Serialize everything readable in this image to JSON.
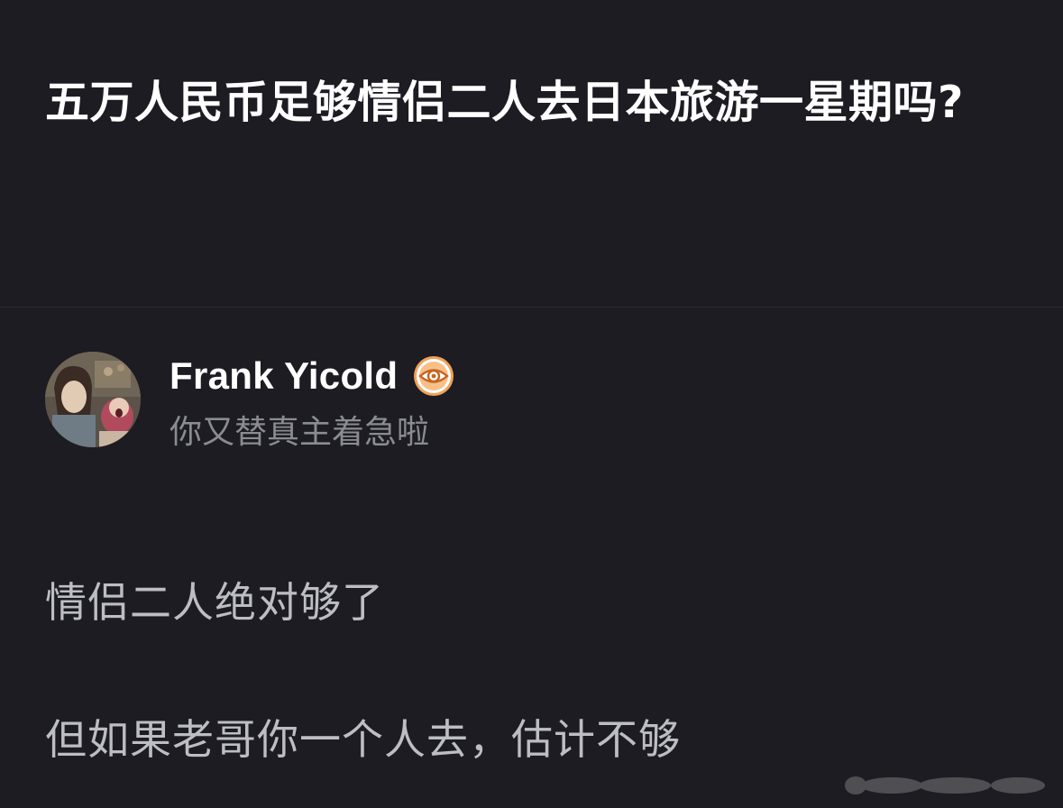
{
  "question": {
    "title": "五万人民币足够情侣二人去日本旅游一星期吗?"
  },
  "answer": {
    "author": {
      "name": "Frank Yicold",
      "bio": "你又替真主着急啦",
      "badge_icon": "verified-badge-icon"
    },
    "paragraphs": [
      "情侣二人绝对够了",
      "但如果老哥你一个人去，估计不够"
    ]
  },
  "colors": {
    "background": "#1c1c22",
    "title": "#ffffff",
    "body_text": "#bdbdc4",
    "bio_text": "#8b8b93",
    "badge": "#e8832e"
  }
}
